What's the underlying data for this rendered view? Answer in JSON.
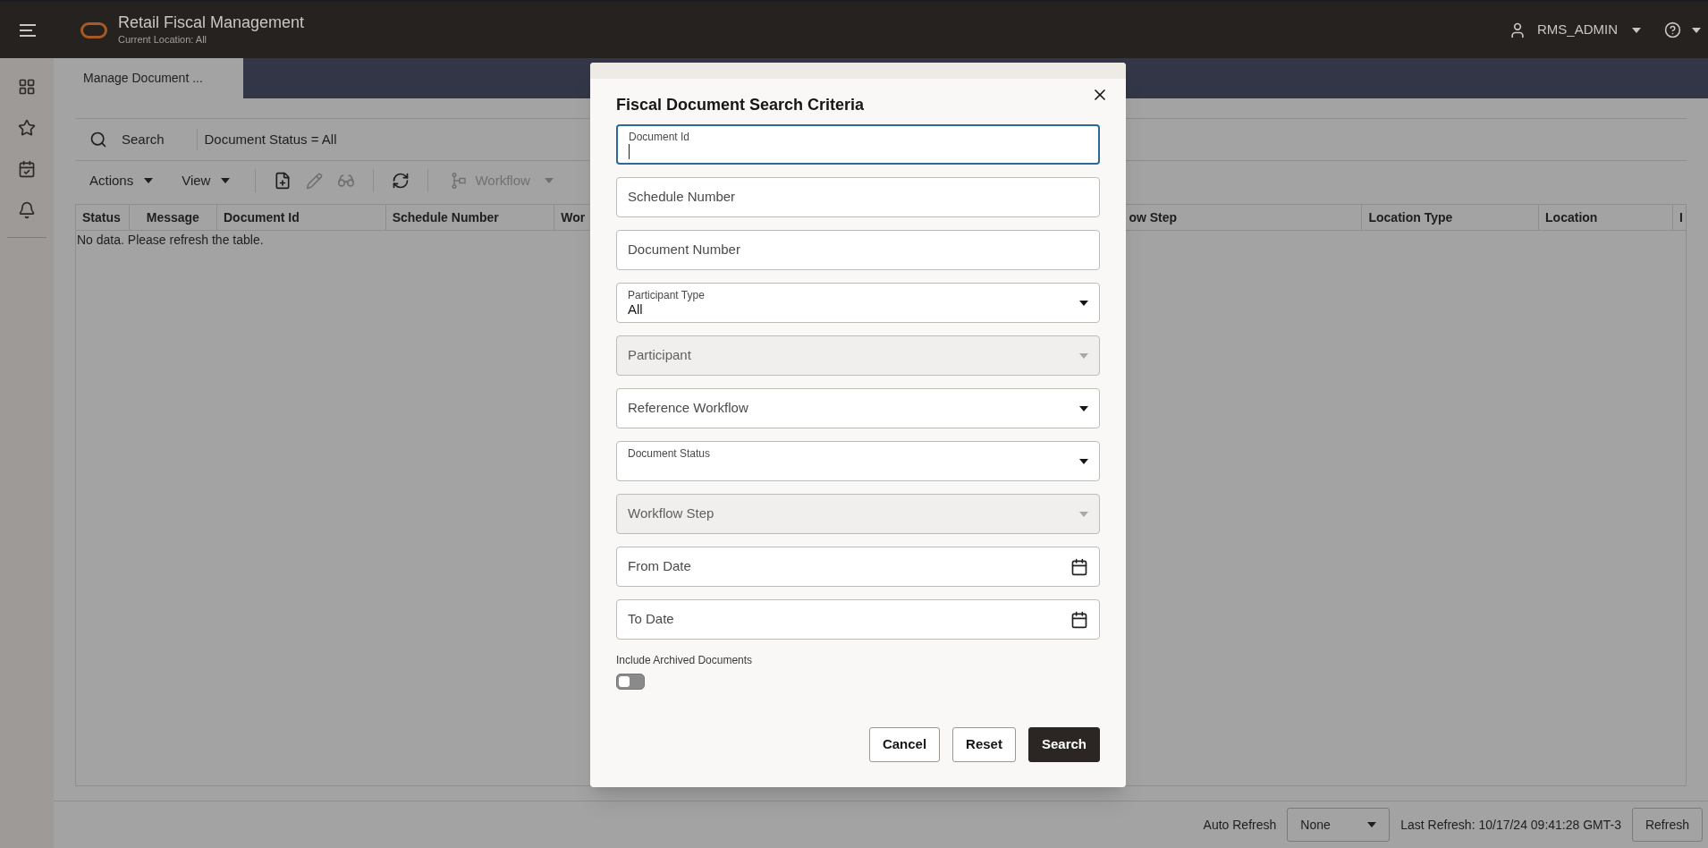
{
  "header": {
    "title": "Retail Fiscal Management",
    "subtitle": "Current Location: All",
    "user": "RMS_ADMIN"
  },
  "tabs": [
    {
      "label": "Manage Document ...",
      "selected": true
    }
  ],
  "search_bar": {
    "label": "Search",
    "filter": "Document Status = All"
  },
  "toolbar": [
    {
      "kind": "menu",
      "label": "Actions",
      "disabled": false
    },
    {
      "kind": "menu",
      "label": "View",
      "disabled": false
    },
    {
      "kind": "new",
      "disabled": false
    },
    {
      "kind": "edit",
      "disabled": true
    },
    {
      "kind": "view",
      "disabled": true
    },
    {
      "kind": "refresh",
      "disabled": false
    },
    {
      "kind": "workflow",
      "label": "Workflow",
      "disabled": true
    }
  ],
  "table": {
    "columns": [
      "Status",
      "Message",
      "Document Id",
      "Schedule Number",
      "Wor",
      "ow Step",
      "Location Type",
      "Location",
      "I"
    ],
    "empty_text": "No data. Please refresh the table."
  },
  "footer": {
    "auto_refresh_label": "Auto Refresh",
    "auto_refresh_value": "None",
    "last_refresh": "Last Refresh: 10/17/24 09:41:28 GMT-3",
    "refresh_button": "Refresh"
  },
  "dialog": {
    "title": "Fiscal Document Search Criteria",
    "fields": [
      {
        "kind": "text",
        "label": "Document Id",
        "raised": true,
        "focused": true,
        "disabled": false
      },
      {
        "kind": "text",
        "label": "Schedule Number",
        "raised": false,
        "focused": false,
        "disabled": false
      },
      {
        "kind": "text",
        "label": "Document Number",
        "raised": false,
        "focused": false,
        "disabled": false
      },
      {
        "kind": "select",
        "label": "Participant Type",
        "value": "All",
        "raised": true,
        "focused": false,
        "disabled": false
      },
      {
        "kind": "select",
        "label": "Participant",
        "raised": false,
        "focused": false,
        "disabled": true
      },
      {
        "kind": "select",
        "label": "Reference Workflow",
        "raised": false,
        "focused": false,
        "disabled": false
      },
      {
        "kind": "select",
        "label": "Document Status",
        "raised": true,
        "focused": false,
        "disabled": false
      },
      {
        "kind": "select",
        "label": "Workflow Step",
        "raised": false,
        "focused": false,
        "disabled": true
      },
      {
        "kind": "date",
        "label": "From Date",
        "raised": false,
        "focused": false,
        "disabled": false
      },
      {
        "kind": "date",
        "label": "To Date",
        "raised": false,
        "focused": false,
        "disabled": false
      }
    ],
    "toggle": {
      "label": "Include Archived Documents",
      "on": false
    },
    "buttons": [
      {
        "kind": "secondary",
        "label": "Cancel"
      },
      {
        "kind": "secondary",
        "label": "Reset"
      },
      {
        "kind": "primary",
        "label": "Search"
      }
    ]
  }
}
